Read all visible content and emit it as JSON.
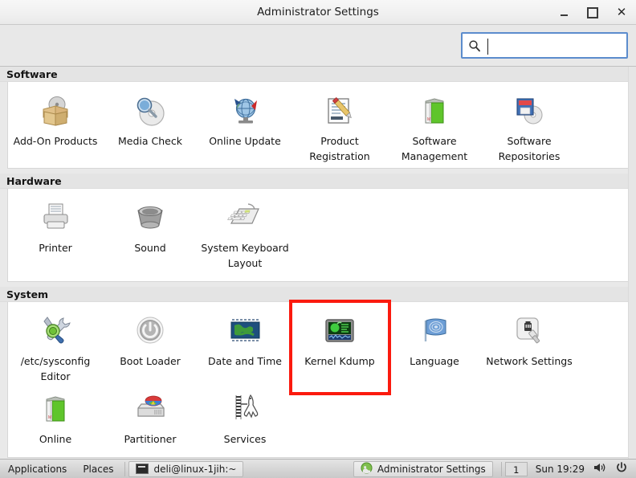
{
  "window": {
    "title": "Administrator Settings",
    "controls": [
      {
        "name": "minimize",
        "label": "–"
      },
      {
        "name": "maximize",
        "label": "□"
      },
      {
        "name": "close",
        "label": "×"
      }
    ]
  },
  "search": {
    "value": "",
    "placeholder": "",
    "icon": "search-icon"
  },
  "groups": [
    {
      "id": "software",
      "title": "Software",
      "items": [
        {
          "label": "Add-On Products",
          "icon": "addon-products-icon"
        },
        {
          "label": "Media Check",
          "icon": "media-check-icon"
        },
        {
          "label": "Online Update",
          "icon": "online-update-icon"
        },
        {
          "label": "Product Registration",
          "icon": "product-registration-icon"
        },
        {
          "label": "Software Management",
          "icon": "software-management-icon"
        },
        {
          "label": "Software Repositories",
          "icon": "software-repositories-icon"
        }
      ]
    },
    {
      "id": "hardware",
      "title": "Hardware",
      "items": [
        {
          "label": "Printer",
          "icon": "printer-icon"
        },
        {
          "label": "Sound",
          "icon": "sound-icon"
        },
        {
          "label": "System Keyboard Layout",
          "icon": "keyboard-icon"
        }
      ]
    },
    {
      "id": "system",
      "title": "System",
      "items": [
        {
          "label": "/etc/sysconfig Editor",
          "icon": "sysconfig-editor-icon"
        },
        {
          "label": "Boot Loader",
          "icon": "boot-loader-icon"
        },
        {
          "label": "Date and Time",
          "icon": "date-time-icon"
        },
        {
          "label": "Kernel Kdump",
          "icon": "kernel-kdump-icon"
        },
        {
          "label": "Language",
          "icon": "language-icon"
        },
        {
          "label": "Network Settings",
          "icon": "network-settings-icon"
        },
        {
          "label": "Online",
          "icon": "online-icon"
        },
        {
          "label": "Partitioner",
          "icon": "partitioner-icon"
        },
        {
          "label": "Services",
          "icon": "services-icon"
        }
      ]
    }
  ],
  "highlight": {
    "target_label": "Kernel Kdump",
    "color": "#fb1a0e"
  },
  "taskbar": {
    "applications_label": "Applications",
    "places_label": "Places",
    "terminal_window_label": "deli@linux-1jih:~",
    "active_window_label": "Administrator Settings",
    "workspace": "1",
    "clock": "Sun 19:29",
    "volume_icon": "volume-icon",
    "power_icon": "power-icon"
  }
}
